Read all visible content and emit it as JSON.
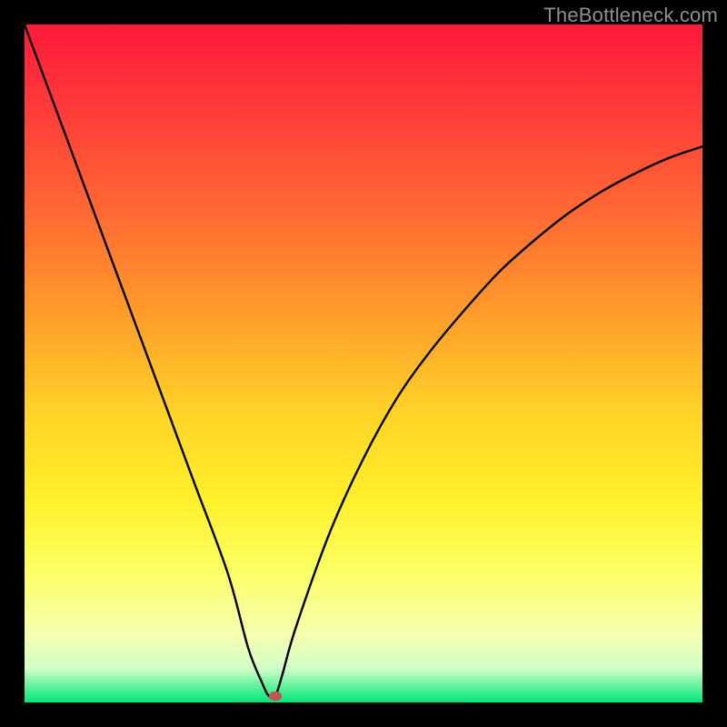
{
  "watermark": "TheBottleneck.com",
  "chart_data": {
    "type": "line",
    "title": "",
    "xlabel": "",
    "ylabel": "",
    "xlim": [
      0,
      100
    ],
    "ylim": [
      0,
      100
    ],
    "grid": false,
    "series": [
      {
        "name": "bottleneck-curve",
        "x": [
          0,
          5,
          10,
          15,
          20,
          25,
          30,
          33,
          35,
          36,
          37,
          38,
          40,
          45,
          50,
          55,
          60,
          65,
          70,
          75,
          80,
          85,
          90,
          95,
          100
        ],
        "y": [
          100,
          86.5,
          73,
          59.5,
          46,
          32.5,
          19,
          8,
          3,
          1,
          1,
          4,
          11,
          25,
          36,
          45,
          52,
          58,
          63.5,
          68,
          72,
          75.3,
          78,
          80.3,
          82
        ]
      }
    ],
    "marker": {
      "x": 37,
      "y": 1,
      "color": "#c05555"
    },
    "background_gradient": [
      "#ff1a3c",
      "#ff3a3a",
      "#ff6a33",
      "#ff9a2a",
      "#ffd528",
      "#fff02a",
      "#fcff60",
      "#f6ffb0",
      "#d0ffc8",
      "#00e676"
    ]
  }
}
